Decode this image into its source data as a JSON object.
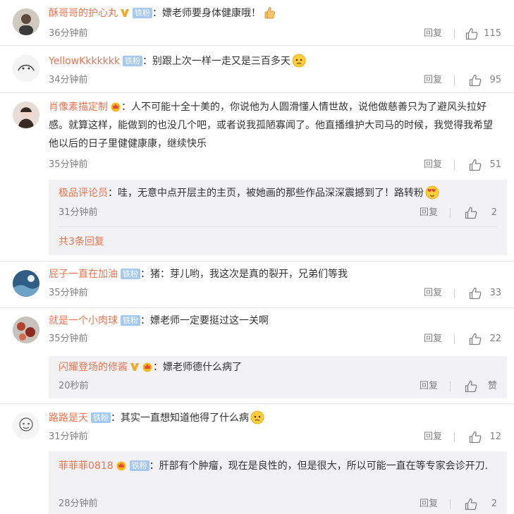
{
  "labels": {
    "reply": "回复",
    "fan_badge": "铁粉"
  },
  "colors": {
    "username": "#eb7350",
    "fan_badge_bg": "#a4c8ef",
    "meta_text": "#808080",
    "subcomment_bg": "#f2f2f5"
  },
  "comments": [
    {
      "user": "酥哥哥的护心丸",
      "text": "：嫖老师要身体健康哦！",
      "time": "36分钟前",
      "likes": "115",
      "emoji": "thumbs-up-emoji",
      "verified": true
    },
    {
      "user": "YellowKkkkkkk",
      "text": "：别跟上次一样一走又是三百多天",
      "time": "34分钟前",
      "likes": "95",
      "emoji": "sad-face-emoji"
    },
    {
      "user": "肖像素描定制",
      "text": "：人不可能十全十美的，你说他为人圆滑懂人情世故，说他做慈善只为了避风头拉好感。就算这样，能做到的也没几个吧，或者说我孤陋寡闻了。他直播维护大司马的时候，我觉得我希望他以后的日子里健健康康，继续快乐",
      "time": "35分钟前",
      "likes": "51"
    },
    {
      "user": "屁子一直在加油",
      "text": "：猪：芽儿哟，我这次是真的裂开，兄弟们等我",
      "time": "35分钟前",
      "likes": "33"
    },
    {
      "user": "就是一个小肉球",
      "text": "：嫖老师一定要挺过这一关啊",
      "time": "35分钟前",
      "likes": "22"
    },
    {
      "user": "路路是天",
      "text": "：其实一直想知道他得了什么病",
      "time": "31分钟前",
      "likes": "12",
      "emoji": "worried-face-emoji"
    }
  ],
  "replies": [
    {
      "user": "极品评论员",
      "text": "：哇，无意中点开层主的主页，被她画的那些作品深深震撼到了！路转粉",
      "time": "31分钟前",
      "likes": "2",
      "more": "共3条回复",
      "emoji": "heart-eyes-emoji"
    },
    {
      "user": "闪耀登场的修酱",
      "text": "：嫖老师德什么病了",
      "time": "20秒前",
      "likes": "赞",
      "verified": true
    },
    {
      "user": "菲菲菲0818",
      "text": "：肝部有个肿瘤，现在是良性的，但是很大，所以可能一直在等专家会诊开刀.",
      "time": "28分钟前",
      "likes": "2"
    }
  ]
}
